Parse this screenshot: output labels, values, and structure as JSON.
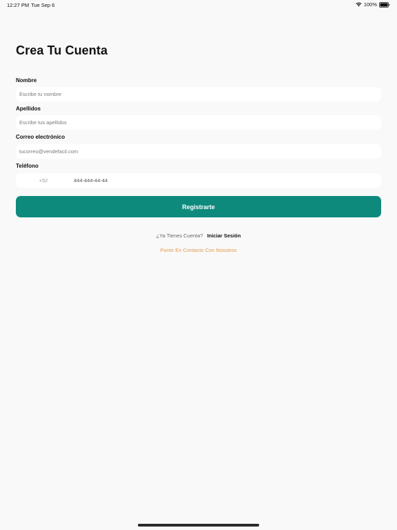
{
  "status_bar": {
    "time": "12:27 PM",
    "date": "Tue Sep 6",
    "battery": "100%"
  },
  "title": "Crea Tu Cuenta",
  "form": {
    "name": {
      "label": "Nombre",
      "placeholder": "Escribe tu nombre",
      "value": ""
    },
    "surname": {
      "label": "Apellidos",
      "placeholder": "Escribe tus apellidos",
      "value": ""
    },
    "email": {
      "label": "Correo electrónico",
      "placeholder": "tucorreo@vendefacil.com",
      "value": ""
    },
    "phone": {
      "label": "Teléfono",
      "country_code": "+52",
      "placeholder": "444-444-44-44",
      "value": ""
    }
  },
  "register_button": "Registrarte",
  "login": {
    "question": "¿Ya Tienes Cuenta?",
    "link": "Iniciar Sesión"
  },
  "contact_link": "Ponte En Contacto Con Nosotros",
  "colors": {
    "accent": "#0e8a7c",
    "contact": "#e39a4c",
    "background": "#f9f9f9"
  }
}
